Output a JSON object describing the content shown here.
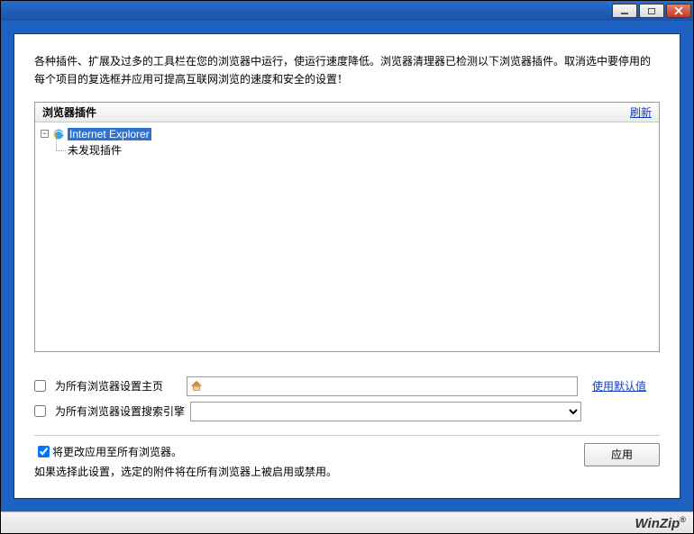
{
  "description": "各种插件、扩展及过多的工具栏在您的浏览器中运行，使运行速度降低。浏览器清理器已检测以下浏览器插件。取消选中要停用的每个项目的复选框并应用可提高互联网浏览的速度和安全的设置！",
  "tree": {
    "title": "浏览器插件",
    "refresh_label": "刷新",
    "browser_name": "Internet Explorer",
    "no_plugin_label": "未发现插件"
  },
  "settings": {
    "set_homepage_label": "为所有浏览器设置主页",
    "homepage_value": "",
    "use_default_label": "使用默认值",
    "set_search_engine_label": "为所有浏览器设置搜索引擎"
  },
  "apply_all_label": "将更改应用至所有浏览器。",
  "apply_hint": "如果选择此设置，选定的附件将在所有浏览器上被启用或禁用。",
  "apply_button_label": "应用",
  "brand": "WinZip",
  "brand_suffix": "®",
  "titlebar": {
    "close_symbol": "✕"
  }
}
